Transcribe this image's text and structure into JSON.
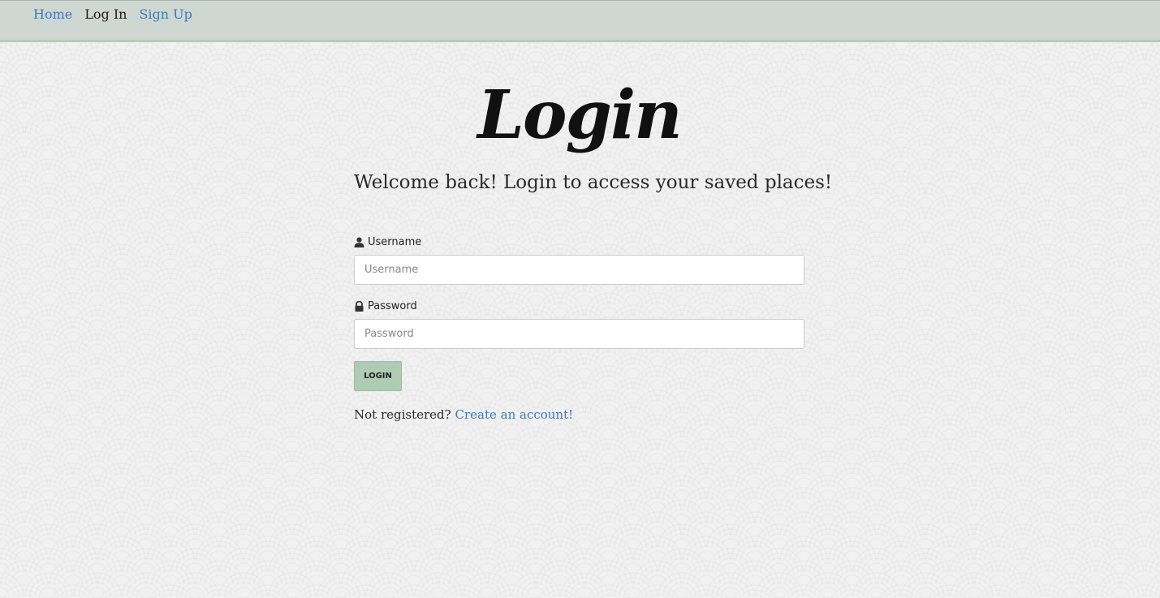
{
  "nav": {
    "links": [
      {
        "label": "Home"
      },
      {
        "label": "Log In"
      },
      {
        "label": "Sign Up"
      }
    ]
  },
  "main": {
    "title": "Login",
    "subtitle": "Welcome back! Login to access your saved places!",
    "username": {
      "label": "Username",
      "placeholder": "Username",
      "value": "",
      "icon": "user-icon"
    },
    "password": {
      "label": "Password",
      "placeholder": "Password",
      "value": "",
      "icon": "lock-icon"
    },
    "login_button": "LOGIN",
    "register_prompt": "Not registered?",
    "register_link": "Create an account!"
  },
  "colors": {
    "navbar_bg": "#cfd7d3",
    "navbar_border": "#b4ceb9",
    "link": "#3d7ab8",
    "button_bg": "#aecbb4",
    "page_bg": "#f1f1f1"
  }
}
